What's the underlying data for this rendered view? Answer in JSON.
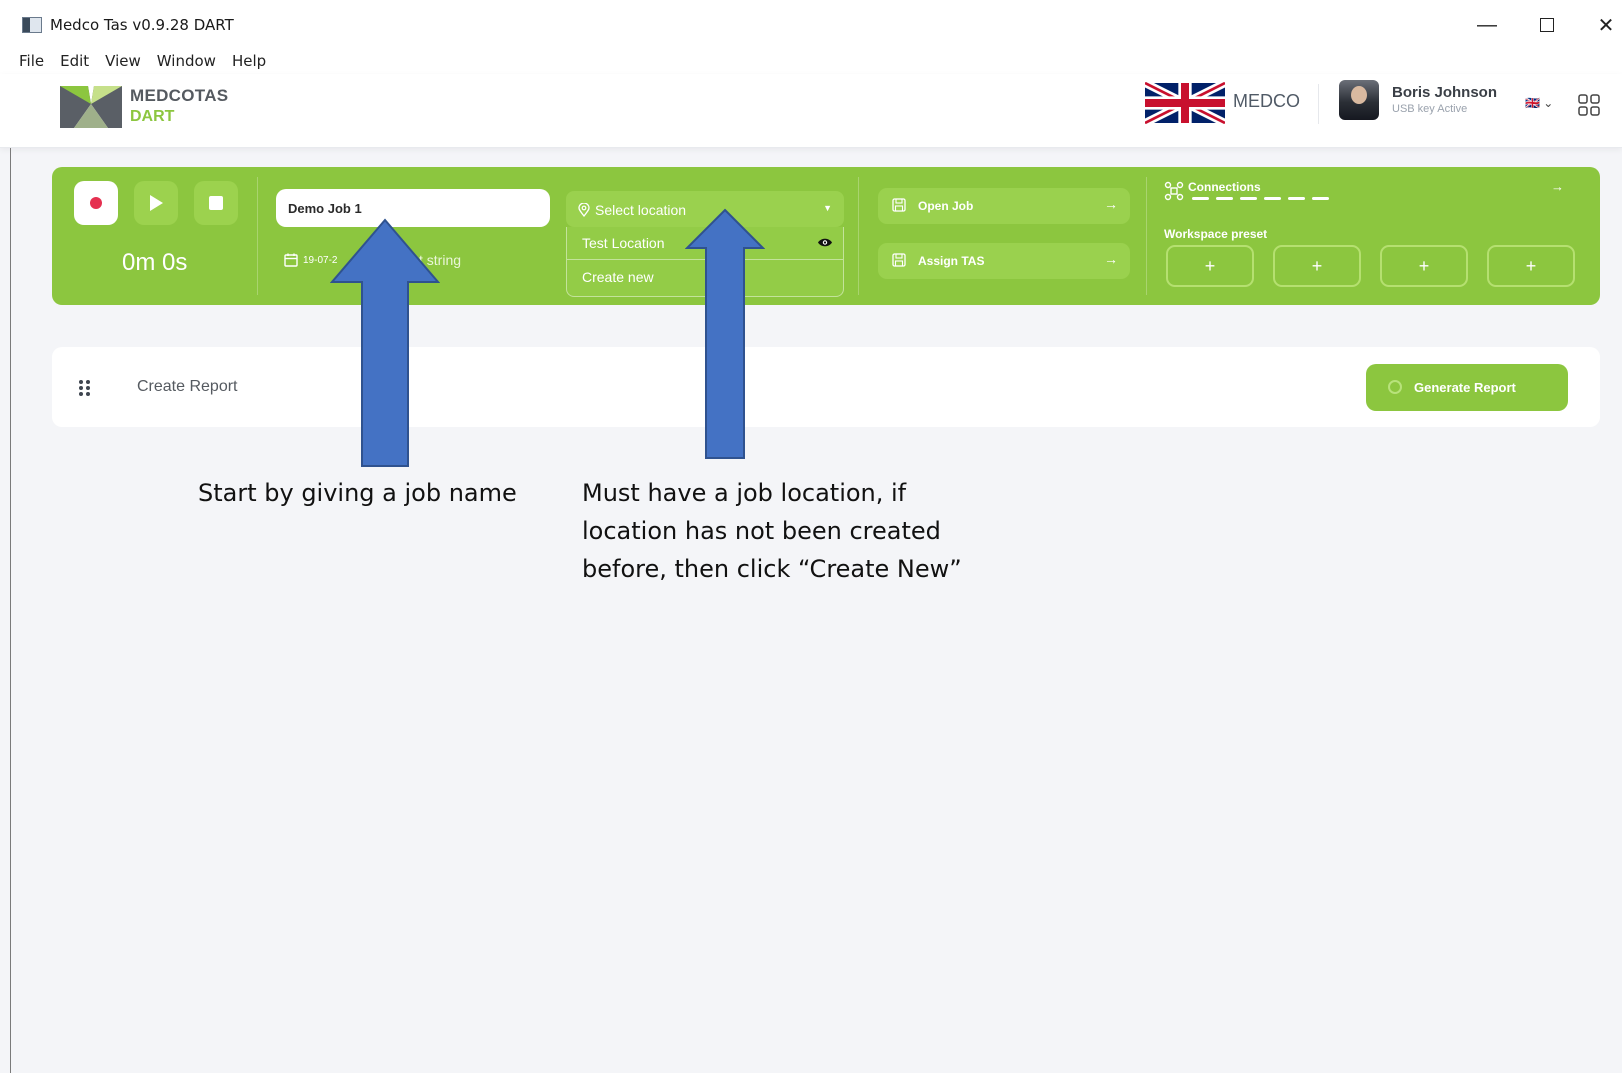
{
  "window": {
    "title": "Medco Tas v0.9.28  DART",
    "minimize": "—",
    "close": "✕"
  },
  "menu": [
    "File",
    "Edit",
    "View",
    "Window",
    "Help"
  ],
  "header": {
    "brand_top": "MEDCOTAS",
    "brand_bottom": "DART",
    "org_label": "MEDCO",
    "user_name": "Boris Johnson",
    "user_status": "USB key Active",
    "lang_label": "🇬🇧 ⌄"
  },
  "controls": {
    "timer": "0m 0s",
    "job_name": "Demo Job 1",
    "date_string": "19-07-2",
    "object_string": "ct string",
    "location_placeholder": "Select location",
    "location_options": [
      "Test Location",
      "Create new"
    ],
    "open_job": "Open Job",
    "assign_tas": "Assign TAS",
    "arrow": "→",
    "connections": "Connections",
    "workspace_preset": "Workspace preset",
    "preset_plus": "+"
  },
  "report": {
    "label": "Create Report",
    "generate": "Generate Report"
  },
  "annotations": {
    "job_name_tip": "Start by giving a job name",
    "location_tip_1": "Must have a job location, if",
    "location_tip_2": "location has not been created",
    "location_tip_3": "before, then click “Create New”"
  },
  "colors": {
    "accent_green": "#8cc63f",
    "record_red": "#e53050",
    "arrow_blue": "#4472c4"
  }
}
